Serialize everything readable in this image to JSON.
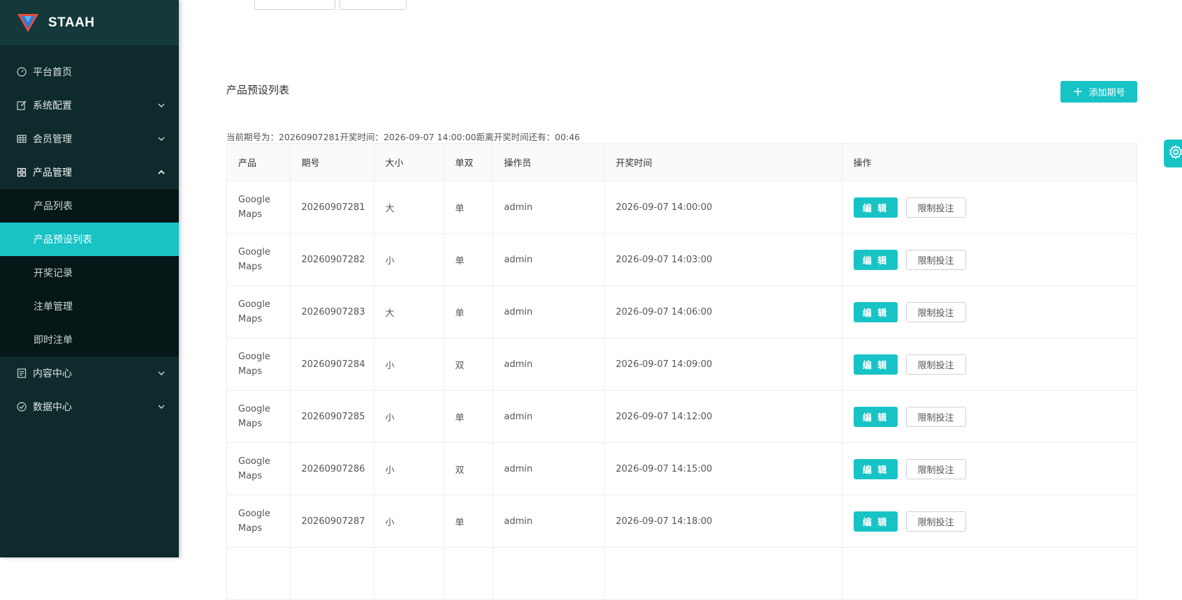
{
  "brand": {
    "name": "STAAH"
  },
  "sidebar": {
    "items": [
      {
        "label": "平台首页",
        "icon": "dashboard-icon"
      },
      {
        "label": "系统配置",
        "icon": "edit-icon"
      },
      {
        "label": "会员管理",
        "icon": "grid-icon"
      },
      {
        "label": "产品管理",
        "icon": "apps-icon"
      },
      {
        "label": "内容中心",
        "icon": "document-icon"
      },
      {
        "label": "数据中心",
        "icon": "check-circle-icon"
      }
    ],
    "product_submenu": [
      {
        "label": "产品列表"
      },
      {
        "label": "产品预设列表"
      },
      {
        "label": "开奖记录"
      },
      {
        "label": "注单管理"
      },
      {
        "label": "即时注单"
      }
    ]
  },
  "main": {
    "title": "产品预设列表",
    "add_button": "添加期号",
    "period_info": "当前期号为：20260907281开奖时间：2026-09-07 14:00:00距离开奖时间还有：00:46",
    "table": {
      "headers": [
        "产品",
        "期号",
        "大小",
        "单双",
        "操作员",
        "开奖时间",
        "操作"
      ],
      "edit_label": "编 辑",
      "limit_label": "限制投注",
      "rows": [
        {
          "product": "Google Maps",
          "period": "20260907281",
          "size": "大",
          "parity": "单",
          "operator": "admin",
          "time": "2026-09-07 14:00:00"
        },
        {
          "product": "Google Maps",
          "period": "20260907282",
          "size": "小",
          "parity": "单",
          "operator": "admin",
          "time": "2026-09-07 14:03:00"
        },
        {
          "product": "Google Maps",
          "period": "20260907283",
          "size": "大",
          "parity": "单",
          "operator": "admin",
          "time": "2026-09-07 14:06:00"
        },
        {
          "product": "Google Maps",
          "period": "20260907284",
          "size": "小",
          "parity": "双",
          "operator": "admin",
          "time": "2026-09-07 14:09:00"
        },
        {
          "product": "Google Maps",
          "period": "20260907285",
          "size": "小",
          "parity": "单",
          "operator": "admin",
          "time": "2026-09-07 14:12:00"
        },
        {
          "product": "Google Maps",
          "period": "20260907286",
          "size": "小",
          "parity": "双",
          "operator": "admin",
          "time": "2026-09-07 14:15:00"
        },
        {
          "product": "Google Maps",
          "period": "20260907287",
          "size": "小",
          "parity": "单",
          "operator": "admin",
          "time": "2026-09-07 14:18:00"
        }
      ]
    }
  },
  "colors": {
    "accent": "#18c3c6",
    "sidebar_bg": "#0f2a2c",
    "submenu_bg": "#061718"
  }
}
